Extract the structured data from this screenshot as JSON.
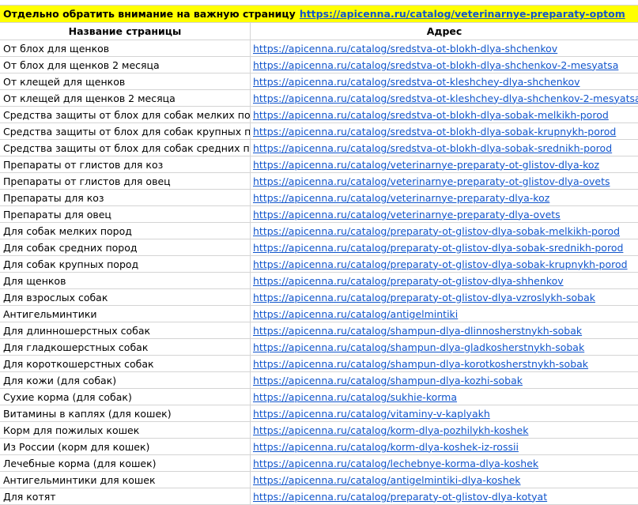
{
  "banner": {
    "text": "Отдельно обратить внимание на важную страницу",
    "link": "https://apicenna.ru/catalog/veterinarnye-preparaty-optom"
  },
  "header": {
    "name": "Название страницы",
    "address": "Адрес"
  },
  "rows": [
    {
      "name": "От блох для щенков",
      "url": "https://apicenna.ru/catalog/sredstva-ot-blokh-dlya-shchenkov"
    },
    {
      "name": "От блох для щенков 2 месяца",
      "url": "https://apicenna.ru/catalog/sredstva-ot-blokh-dlya-shchenkov-2-mesyatsa"
    },
    {
      "name": "От клещей для щенков",
      "url": "https://apicenna.ru/catalog/sredstva-ot-kleshchey-dlya-shchenkov"
    },
    {
      "name": "От клещей для щенков 2 месяца",
      "url": "https://apicenna.ru/catalog/sredstva-ot-kleshchey-dlya-shchenkov-2-mesyatsa"
    },
    {
      "name": "Средства защиты от блох для собак мелких пород",
      "url": "https://apicenna.ru/catalog/sredstva-ot-blokh-dlya-sobak-melkikh-porod"
    },
    {
      "name": "Средства защиты от блох для собак крупных пород",
      "url": "https://apicenna.ru/catalog/sredstva-ot-blokh-dlya-sobak-krupnykh-porod"
    },
    {
      "name": "Средства защиты от блох для собак средних пород",
      "url": "https://apicenna.ru/catalog/sredstva-ot-blokh-dlya-sobak-srednikh-porod"
    },
    {
      "name": "Препараты от глистов для коз",
      "url": "https://apicenna.ru/catalog/veterinarnye-preparaty-ot-glistov-dlya-koz"
    },
    {
      "name": "Препараты от глистов для овец",
      "url": "https://apicenna.ru/catalog/veterinarnye-preparaty-ot-glistov-dlya-ovets"
    },
    {
      "name": "Препараты для коз",
      "url": "https://apicenna.ru/catalog/veterinarnye-preparaty-dlya-koz"
    },
    {
      "name": "Препараты для овец",
      "url": "https://apicenna.ru/catalog/veterinarnye-preparaty-dlya-ovets"
    },
    {
      "name": "Для собак мелких пород",
      "url": "https://apicenna.ru/catalog/preparaty-ot-glistov-dlya-sobak-melkikh-porod"
    },
    {
      "name": "Для собак средних пород",
      "url": "https://apicenna.ru/catalog/preparaty-ot-glistov-dlya-sobak-srednikh-porod"
    },
    {
      "name": "Для собак крупных пород",
      "url": "https://apicenna.ru/catalog/preparaty-ot-glistov-dlya-sobak-krupnykh-porod"
    },
    {
      "name": "Для щенков",
      "url": "https://apicenna.ru/catalog/preparaty-ot-glistov-dlya-shhenkov"
    },
    {
      "name": "Для взрослых собак",
      "url": "https://apicenna.ru/catalog/preparaty-ot-glistov-dlya-vzroslykh-sobak"
    },
    {
      "name": "Антигельминтики",
      "url": "https://apicenna.ru/catalog/antigelmintiki"
    },
    {
      "name": "Для длинношерстных собак",
      "url": "https://apicenna.ru/catalog/shampun-dlya-dlinnosherstnykh-sobak"
    },
    {
      "name": "Для гладкошерстных собак",
      "url": "https://apicenna.ru/catalog/shampun-dlya-gladkosherstnykh-sobak"
    },
    {
      "name": "Для короткошерстных собак",
      "url": "https://apicenna.ru/catalog/shampun-dlya-korotkosherstnykh-sobak"
    },
    {
      "name": "Для кожи (для собак)",
      "url": "https://apicenna.ru/catalog/shampun-dlya-kozhi-sobak"
    },
    {
      "name": "Сухие корма (для собак)",
      "url": "https://apicenna.ru/catalog/sukhie-korma"
    },
    {
      "name": "Витамины в каплях (для кошек)",
      "url": "https://apicenna.ru/catalog/vitaminy-v-kaplyakh"
    },
    {
      "name": "Корм для пожилых кошек",
      "url": "https://apicenna.ru/catalog/korm-dlya-pozhilykh-koshek"
    },
    {
      "name": "Из России (корм для кошек)",
      "url": "https://apicenna.ru/catalog/korm-dlya-koshek-iz-rossii"
    },
    {
      "name": "Лечебные корма (для кошек)",
      "url": "https://apicenna.ru/catalog/lechebnye-korma-dlya-koshek"
    },
    {
      "name": "Антигельминтики для кошек",
      "url": "https://apicenna.ru/catalog/antigelmintiki-dlya-koshek"
    },
    {
      "name": "Для котят",
      "url": "https://apicenna.ru/catalog/preparaty-ot-glistov-dlya-kotyat"
    }
  ],
  "colors": {
    "banner_bg": "#ffff00",
    "link": "#1155cc",
    "gridline": "#d4d4d4"
  }
}
